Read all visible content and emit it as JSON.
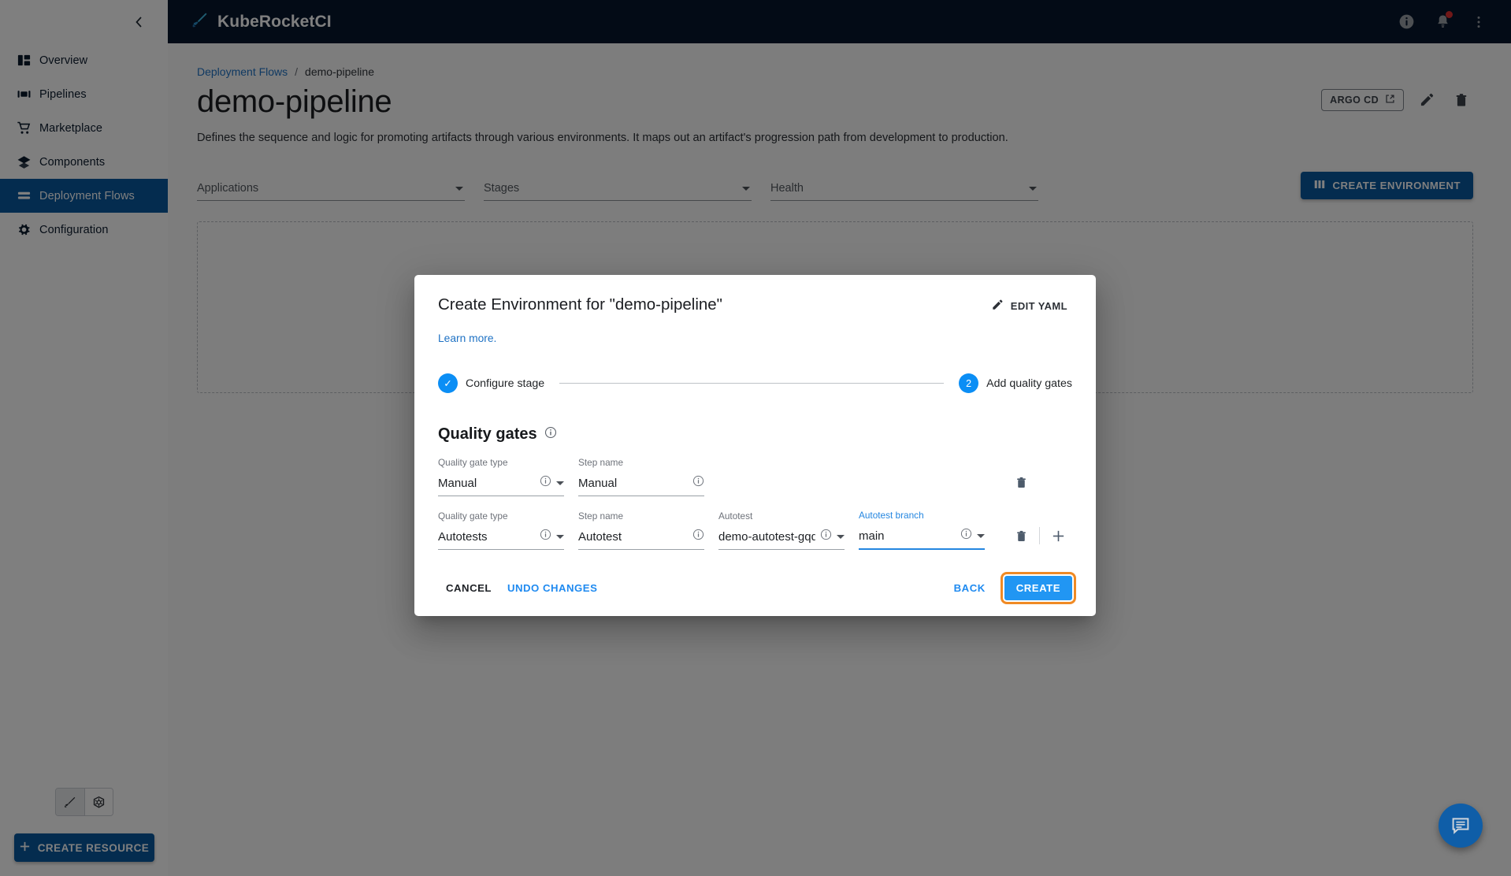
{
  "app": {
    "brand": "KubeRocketCI",
    "accent_blue": "#08589e",
    "step_blue": "#0b8ef5",
    "highlight_orange": "#f08a24"
  },
  "sidebar": {
    "collapse_icon": "chevron-left-icon",
    "items": [
      {
        "label": "Overview",
        "icon": "dashboard-icon",
        "active": false
      },
      {
        "label": "Pipelines",
        "icon": "pipelines-icon",
        "active": false
      },
      {
        "label": "Marketplace",
        "icon": "cart-icon",
        "active": false
      },
      {
        "label": "Components",
        "icon": "layers-icon",
        "active": false
      },
      {
        "label": "Deployment Flows",
        "icon": "flows-icon",
        "active": true
      },
      {
        "label": "Configuration",
        "icon": "gear-icon",
        "active": false
      }
    ],
    "cluster_toggle": [
      {
        "icon": "sword-icon",
        "selected": true
      },
      {
        "icon": "kubernetes-icon",
        "selected": false
      }
    ],
    "create_resource_label": "CREATE RESOURCE"
  },
  "appbar": {
    "info_icon": "info-icon",
    "notifications_icon": "bell-icon",
    "has_notification": true,
    "menu_icon": "more-vertical-icon"
  },
  "breadcrumb": {
    "parent": "Deployment Flows",
    "separator": "/",
    "current": "demo-pipeline"
  },
  "page": {
    "title": "demo-pipeline",
    "description": "Defines the sequence and logic for promoting artifacts through various environments. It maps out an artifact's progression path from development to production.",
    "argo_button": "ARGO CD",
    "edit_icon": "pencil-icon",
    "delete_icon": "trash-icon"
  },
  "filters": [
    {
      "label": "Applications"
    },
    {
      "label": "Stages"
    },
    {
      "label": "Health"
    }
  ],
  "create_environment_button": "CREATE ENVIRONMENT",
  "modal": {
    "title": "Create Environment for \"demo-pipeline\"",
    "edit_yaml": "EDIT YAML",
    "learn_more": "Learn more.",
    "steps": [
      {
        "marker": "✓",
        "label": "Configure stage",
        "state": "complete"
      },
      {
        "marker": "2",
        "label": "Add quality gates",
        "state": "current"
      }
    ],
    "quality_gates": {
      "heading": "Quality gates",
      "info_icon": "info-icon",
      "rows": [
        {
          "fields": [
            {
              "name": "quality-gate-type",
              "label": "Quality gate type",
              "value": "Manual",
              "has_info": true,
              "has_caret": true,
              "focused": false
            },
            {
              "name": "step-name",
              "label": "Step name",
              "value": "Manual",
              "has_info": true,
              "has_caret": false,
              "focused": false
            }
          ],
          "has_delete": true,
          "has_add": false
        },
        {
          "fields": [
            {
              "name": "quality-gate-type",
              "label": "Quality gate type",
              "value": "Autotests",
              "has_info": true,
              "has_caret": true,
              "focused": false
            },
            {
              "name": "step-name",
              "label": "Step name",
              "value": "Autotest",
              "has_info": true,
              "has_caret": false,
              "focused": false
            },
            {
              "name": "autotest",
              "label": "Autotest",
              "value": "demo-autotest-gqdx",
              "has_info": true,
              "has_caret": true,
              "focused": false
            },
            {
              "name": "autotest-branch",
              "label": "Autotest branch",
              "value": "main",
              "has_info": true,
              "has_caret": true,
              "focused": true
            }
          ],
          "has_delete": true,
          "has_add": true
        }
      ]
    },
    "footer": {
      "cancel": "CANCEL",
      "undo_changes": "UNDO CHANGES",
      "back": "BACK",
      "create": "CREATE"
    }
  },
  "chat_fab": {
    "icon": "chat-icon"
  }
}
